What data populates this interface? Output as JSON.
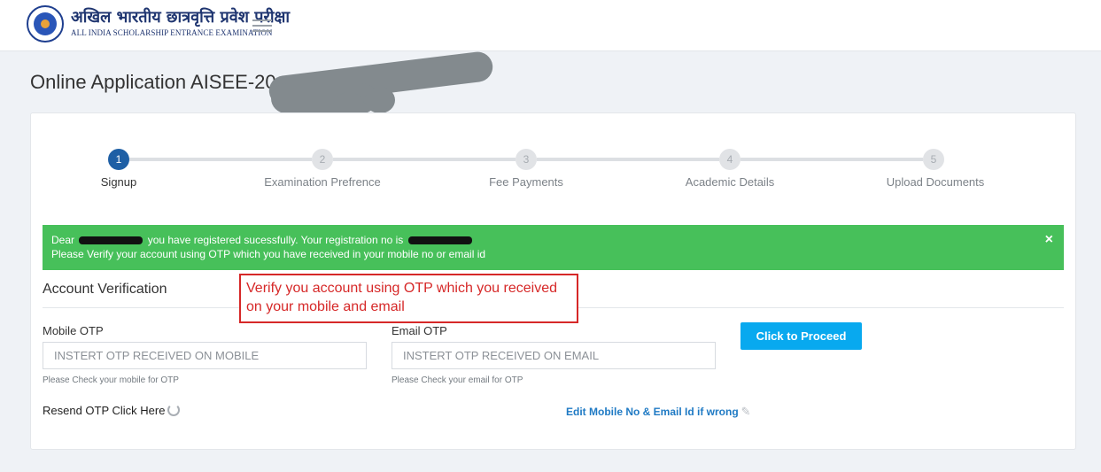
{
  "header": {
    "brand_hindi": "अखिल भारतीय छात्रवृत्ति प्रवेश परीक्षा",
    "brand_english": "ALL INDIA SCHOLARSHIP ENTRANCE EXAMINATION",
    "menu_icon": "hamburger-icon"
  },
  "page": {
    "title": "Online Application AISEE-20"
  },
  "steps": [
    {
      "number": "1",
      "label": "Signup",
      "active": true
    },
    {
      "number": "2",
      "label": "Examination Prefrence",
      "active": false
    },
    {
      "number": "3",
      "label": "Fee Payments",
      "active": false
    },
    {
      "number": "4",
      "label": "Academic Details",
      "active": false
    },
    {
      "number": "5",
      "label": "Upload Documents",
      "active": false
    }
  ],
  "alert": {
    "dear": "Dear",
    "registered": "you have registered sucessfully. Your registration no is",
    "line2": "Please Verify your account using OTP which you have received in your mobile no or email id",
    "close": "×",
    "color": "#47c05a"
  },
  "verification": {
    "title": "Account Verification",
    "callout": "Verify you account using OTP which you received on your mobile and email",
    "mobile": {
      "label": "Mobile OTP",
      "placeholder": "INSTERT OTP RECEIVED ON MOBILE",
      "help": "Please Check your mobile for OTP"
    },
    "email": {
      "label": "Email OTP",
      "placeholder": "INSTERT OTP RECEIVED ON EMAIL",
      "help": "Please Check your email for OTP"
    },
    "proceed_label": "Click to Proceed",
    "resend_label": "Resend OTP Click Here",
    "edit_label": "Edit Mobile No & Email Id if wrong"
  },
  "colors": {
    "primary_button": "#08a9ef",
    "active_step": "#1e5fa5",
    "callout_border": "#d62828"
  }
}
